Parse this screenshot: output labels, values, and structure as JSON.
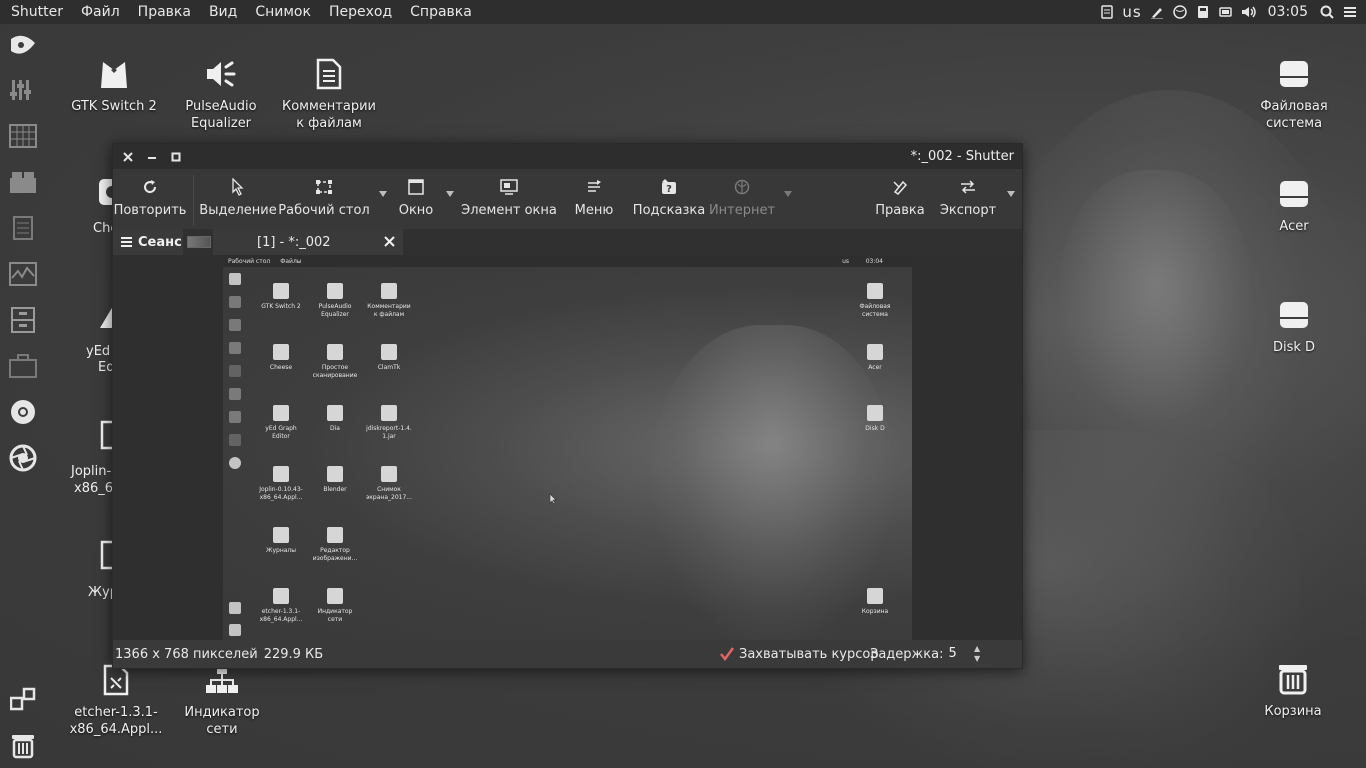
{
  "top_panel": {
    "app_name": "Shutter",
    "menus": [
      "Файл",
      "Правка",
      "Вид",
      "Снимок",
      "Переход",
      "Справка"
    ],
    "keyboard_layout": "us",
    "clock": "03:05"
  },
  "desktop_icons": {
    "gtk_switch": "GTK Switch 2",
    "pulseaudio": "PulseAudio Equalizer",
    "comments": "Комментарии к файлам",
    "filesystem": "Файловая система",
    "acer": "Acer",
    "disk_d": "Disk D",
    "cheese_partial": "Che",
    "yed_partial_1": "yEd",
    "yed_partial_2": "Ed",
    "joplin_partial_1": "Joplin-",
    "joplin_partial_2": "x86_6",
    "journal_partial": "Жур",
    "etcher": "etcher-1.3.1-x86_64.Appl...",
    "network": "Индикатор сети",
    "trash": "Корзина"
  },
  "window": {
    "title": "*:_002 - Shutter",
    "toolbar": {
      "redo": "Повторить",
      "selection": "Выделение",
      "desktop": "Рабочий стол",
      "window": "Окно",
      "window_element": "Элемент окна",
      "menu": "Меню",
      "tooltip": "Подсказка",
      "internet": "Интернет",
      "edit": "Правка",
      "export": "Экспорт"
    },
    "tabs": {
      "session": "Сеанс",
      "doc": "[1] - *:_002"
    },
    "status": {
      "dimensions": "1366 x 768 пикселей",
      "size": "229.9 КБ",
      "capture_cursor": "Захватывать курсор",
      "delay_label": "Задержка:",
      "delay_value": "5"
    }
  },
  "screenshot": {
    "panel_menus": [
      "Рабочий стол",
      "Файлы"
    ],
    "keyboard_layout": "us",
    "clock": "03:04",
    "icons": [
      {
        "line1": "GTK Switch 2",
        "line2": ""
      },
      {
        "line1": "PulseAudio",
        "line2": "Equalizer"
      },
      {
        "line1": "Комментарии",
        "line2": "к файлам"
      },
      {
        "line1": "Cheese",
        "line2": ""
      },
      {
        "line1": "Простое",
        "line2": "сканирование"
      },
      {
        "line1": "ClamTk",
        "line2": ""
      },
      {
        "line1": "yEd Graph",
        "line2": "Editor"
      },
      {
        "line1": "Dia",
        "line2": ""
      },
      {
        "line1": "jdiskreport-1.4.",
        "line2": "1.jar"
      },
      {
        "line1": "Joplin-0.10.43-",
        "line2": "x86_64.Appl..."
      },
      {
        "line1": "Blender",
        "line2": ""
      },
      {
        "line1": "Снимок",
        "line2": "экрана_2017..."
      },
      {
        "line1": "Журналы",
        "line2": ""
      },
      {
        "line1": "Редактор",
        "line2": "изображени..."
      },
      {
        "line1": "etcher-1.3.1-",
        "line2": "x86_64.Appl..."
      },
      {
        "line1": "Индикатор",
        "line2": "сети"
      }
    ],
    "right_icons": [
      {
        "line1": "Файловая",
        "line2": "система"
      },
      {
        "line1": "Acer",
        "line2": ""
      },
      {
        "line1": "Disk D",
        "line2": ""
      },
      {
        "line1": "Корзина",
        "line2": ""
      }
    ]
  },
  "colors": {
    "panel": "#2e2e2e",
    "window_bg": "#3a3a3a",
    "checkbox_accent": "#e06666"
  }
}
